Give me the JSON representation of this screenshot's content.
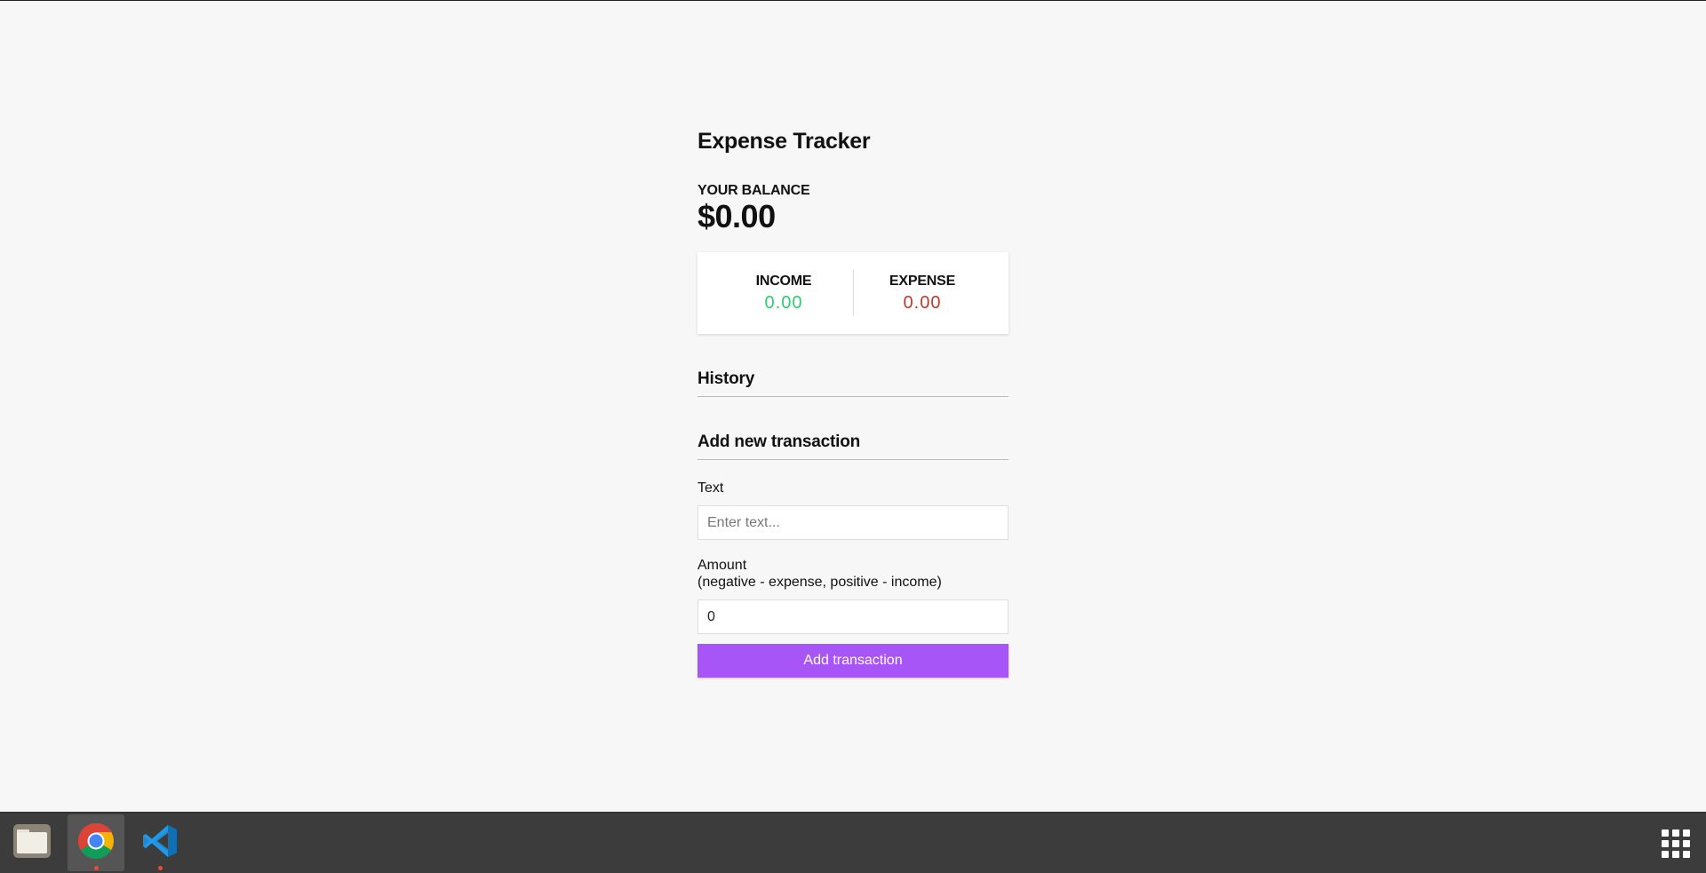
{
  "app": {
    "title": "Expense Tracker",
    "balance_label": "YOUR BALANCE",
    "balance_value": "$0.00",
    "income_label": "INCOME",
    "income_value": "0.00",
    "expense_label": "EXPENSE",
    "expense_value": "0.00",
    "income_color": "#2ecc71",
    "expense_color": "#c0392b"
  },
  "history": {
    "title": "History",
    "items": []
  },
  "form": {
    "title": "Add new transaction",
    "text_label": "Text",
    "text_placeholder": "Enter text...",
    "text_value": "",
    "amount_label_line1": "Amount",
    "amount_label_line2": "(negative - expense, positive - income)",
    "amount_value": "0",
    "submit_label": "Add transaction",
    "accent_color": "#a855f7"
  },
  "taskbar": {
    "apps": [
      {
        "name": "files-icon",
        "active": false
      },
      {
        "name": "chrome-icon",
        "active": true,
        "running": true
      },
      {
        "name": "vscode-icon",
        "active": false,
        "running": true
      }
    ],
    "app_grid_icon": "apps-grid-icon"
  }
}
